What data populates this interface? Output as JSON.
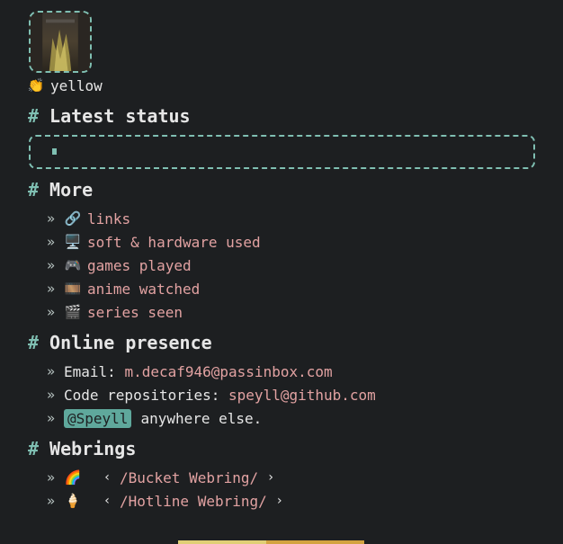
{
  "profile": {
    "status_emoji": "👏",
    "status_text": "yellow",
    "avatar_icon": "avatar-image"
  },
  "sections": {
    "latest_status": {
      "hash": "#",
      "title": "Latest status"
    },
    "more": {
      "hash": "#",
      "title": "More",
      "items": [
        {
          "emoji": "🔗",
          "label": "links"
        },
        {
          "emoji": "🖥️",
          "label": "soft & hardware used"
        },
        {
          "emoji": "🎮",
          "label": "games played"
        },
        {
          "emoji": "🎞️",
          "label": "anime watched"
        },
        {
          "emoji": "🎬",
          "label": "series seen"
        }
      ]
    },
    "online": {
      "hash": "#",
      "title": "Online presence",
      "email_label": "Email: ",
      "email_value": "m.decaf946@passinbox.com",
      "repos_label": "Code repositories: ",
      "repos_value": "speyll@github.com",
      "handle": "@Speyll",
      "handle_suffix": "anywhere else."
    },
    "webrings": {
      "hash": "#",
      "title": "Webrings",
      "items": [
        {
          "emoji": "🌈",
          "prev": "‹",
          "label": "/Bucket Webring/",
          "next": "›"
        },
        {
          "emoji": "🍦",
          "prev": "‹",
          "label": "/Hotline Webring/",
          "next": "›"
        }
      ]
    }
  },
  "bullet": "»",
  "colors": {
    "background": "#1d1f21",
    "accent": "#7fbfb2",
    "link": "#e2a2a2",
    "tag_bg": "#5fa89c",
    "footer_left": "#e0cf76",
    "footer_right": "#d3a340"
  }
}
